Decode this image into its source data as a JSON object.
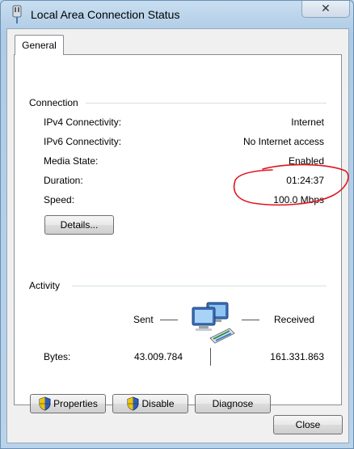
{
  "window": {
    "title": "Local Area Connection Status",
    "close_symbol": "✕"
  },
  "tabs": [
    {
      "label": "General",
      "selected": true
    }
  ],
  "connection": {
    "heading": "Connection",
    "rows": [
      {
        "label": "IPv4 Connectivity:",
        "value": "Internet"
      },
      {
        "label": "IPv6 Connectivity:",
        "value": "No Internet access"
      },
      {
        "label": "Media State:",
        "value": "Enabled"
      },
      {
        "label": "Duration:",
        "value": "01:24:37"
      },
      {
        "label": "Speed:",
        "value": "100.0 Mbps"
      }
    ],
    "details_button": "Details..."
  },
  "activity": {
    "heading": "Activity",
    "sent_label": "Sent",
    "received_label": "Received",
    "bytes_label": "Bytes:",
    "bytes_sent": "43.009.784",
    "bytes_received": "161.331.863",
    "icon": "network-computers-icon"
  },
  "buttons": {
    "properties": "Properties",
    "disable": "Disable",
    "diagnose": "Diagnose",
    "close": "Close"
  },
  "colors": {
    "annotation": "#e0141e",
    "shield_blue": "#2f5fb3",
    "shield_yellow": "#f2c200"
  }
}
